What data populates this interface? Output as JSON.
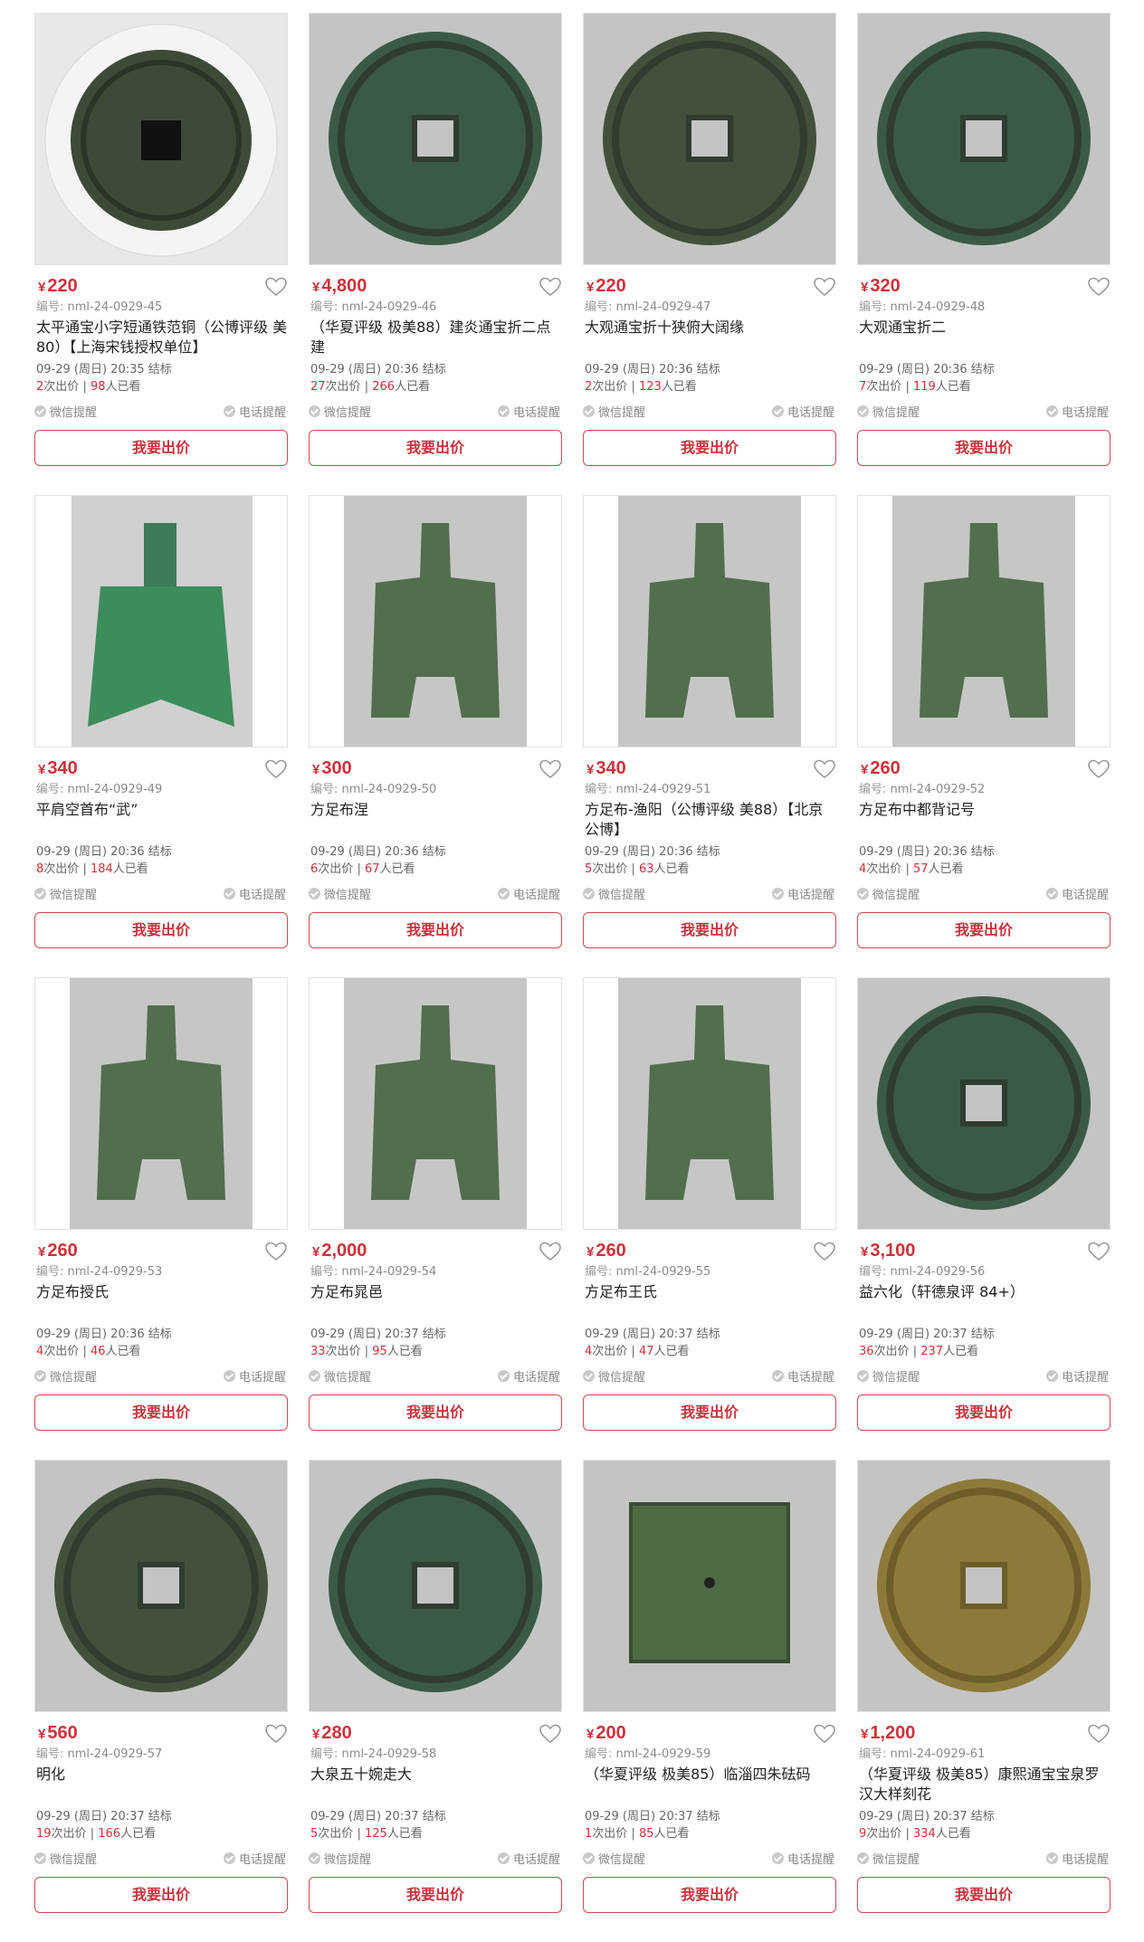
{
  "colors": {
    "price": "#d0303a",
    "button_border": "#c94a50",
    "thumb_bg": "#c7c8c6"
  },
  "labels": {
    "code_prefix": "编号:",
    "bids_suffix": "次出价",
    "separator": "|",
    "views_suffix": "人已看",
    "wechat": "微信提醒",
    "phone": "电话提醒",
    "bid_button": "我要出价",
    "yen": "¥",
    "heart_icon": "heart-outline-icon"
  },
  "items": [
    {
      "price": "220",
      "code": "nml-24-0929-45",
      "title": "太平通宝小字短通铁范铜（公博评级 美80）【上海宋钱授权单位】",
      "time": "09-29 (周日) 20:35 结标",
      "bids": "2",
      "views": "98",
      "image": "round-coin-in-holder"
    },
    {
      "price": "4,800",
      "code": "nml-24-0929-46",
      "title": "（华夏评级 极美88）建炎通宝折二点建",
      "time": "09-29 (周日) 20:36 结标",
      "bids": "27",
      "views": "266",
      "image": "round-coin"
    },
    {
      "price": "220",
      "code": "nml-24-0929-47",
      "title": "大观通宝折十狭俯大阔缘",
      "time": "09-29 (周日) 20:36 结标",
      "bids": "2",
      "views": "123",
      "image": "round-coin"
    },
    {
      "price": "320",
      "code": "nml-24-0929-48",
      "title": "大观通宝折二",
      "time": "09-29 (周日) 20:36 结标",
      "bids": "7",
      "views": "119",
      "image": "round-coin"
    },
    {
      "price": "340",
      "code": "nml-24-0929-49",
      "title": "平肩空首布“武”",
      "time": "09-29 (周日) 20:36 结标",
      "bids": "8",
      "views": "184",
      "image": "spade-coin-hollow"
    },
    {
      "price": "300",
      "code": "nml-24-0929-50",
      "title": "方足布涅",
      "time": "09-29 (周日) 20:36 结标",
      "bids": "6",
      "views": "67",
      "image": "spade-coin"
    },
    {
      "price": "340",
      "code": "nml-24-0929-51",
      "title": "方足布-渔阳（公博评级 美88）【北京公博】",
      "time": "09-29 (周日) 20:36 结标",
      "bids": "5",
      "views": "63",
      "image": "spade-coin"
    },
    {
      "price": "260",
      "code": "nml-24-0929-52",
      "title": "方足布中都背记号",
      "time": "09-29 (周日) 20:36 结标",
      "bids": "4",
      "views": "57",
      "image": "spade-coin"
    },
    {
      "price": "260",
      "code": "nml-24-0929-53",
      "title": "方足布授氏",
      "time": "09-29 (周日) 20:36 结标",
      "bids": "4",
      "views": "46",
      "image": "spade-coin"
    },
    {
      "price": "2,000",
      "code": "nml-24-0929-54",
      "title": "方足布晁邑",
      "time": "09-29 (周日) 20:37 结标",
      "bids": "33",
      "views": "95",
      "image": "spade-coin"
    },
    {
      "price": "260",
      "code": "nml-24-0929-55",
      "title": "方足布王氏",
      "time": "09-29 (周日) 20:37 结标",
      "bids": "4",
      "views": "47",
      "image": "spade-coin"
    },
    {
      "price": "3,100",
      "code": "nml-24-0929-56",
      "title": "益六化（轩德泉评 84+）",
      "time": "09-29 (周日) 20:37 结标",
      "bids": "36",
      "views": "237",
      "image": "round-coin"
    },
    {
      "price": "560",
      "code": "nml-24-0929-57",
      "title": "明化",
      "time": "09-29 (周日) 20:37 结标",
      "bids": "19",
      "views": "166",
      "image": "round-coin"
    },
    {
      "price": "280",
      "code": "nml-24-0929-58",
      "title": "大泉五十婉走大",
      "time": "09-29 (周日) 20:37 结标",
      "bids": "5",
      "views": "125",
      "image": "round-coin"
    },
    {
      "price": "200",
      "code": "nml-24-0929-59",
      "title": "（华夏评级 极美85）临淄四朱砝码",
      "time": "09-29 (周日) 20:37 结标",
      "bids": "1",
      "views": "85",
      "image": "square-weight"
    },
    {
      "price": "1,200",
      "code": "nml-24-0929-61",
      "title": "（华夏评级 极美85）康熙通宝宝泉罗汉大样刻花",
      "time": "09-29 (周日) 20:37 结标",
      "bids": "9",
      "views": "334",
      "image": "brass-coin"
    }
  ]
}
